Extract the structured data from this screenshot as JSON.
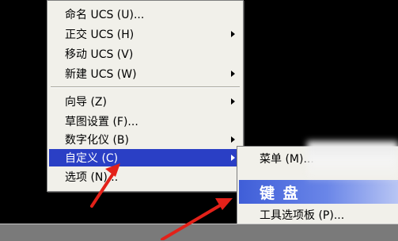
{
  "main_menu": {
    "items": [
      {
        "label": "命名 UCS (U)..."
      },
      {
        "label": "正交 UCS (H)"
      },
      {
        "label": "移动 UCS (V)"
      },
      {
        "label": "新建 UCS (W)"
      },
      {
        "label": "向导 (Z)"
      },
      {
        "label": "草图设置 (F)..."
      },
      {
        "label": "数字化仪 (B)"
      },
      {
        "label": "自定义 (C)"
      },
      {
        "label": "选项 (N)..."
      }
    ]
  },
  "sub_menu": {
    "items": [
      {
        "label": "菜单 (M)..."
      },
      {
        "label": "键 盘"
      },
      {
        "label": "工具选项板 (P)..."
      }
    ]
  },
  "colors": {
    "menu_background": "#f1f0ea",
    "highlight": "#2a3fc5",
    "annotation_arrow": "#e32119",
    "background": "#000000"
  }
}
